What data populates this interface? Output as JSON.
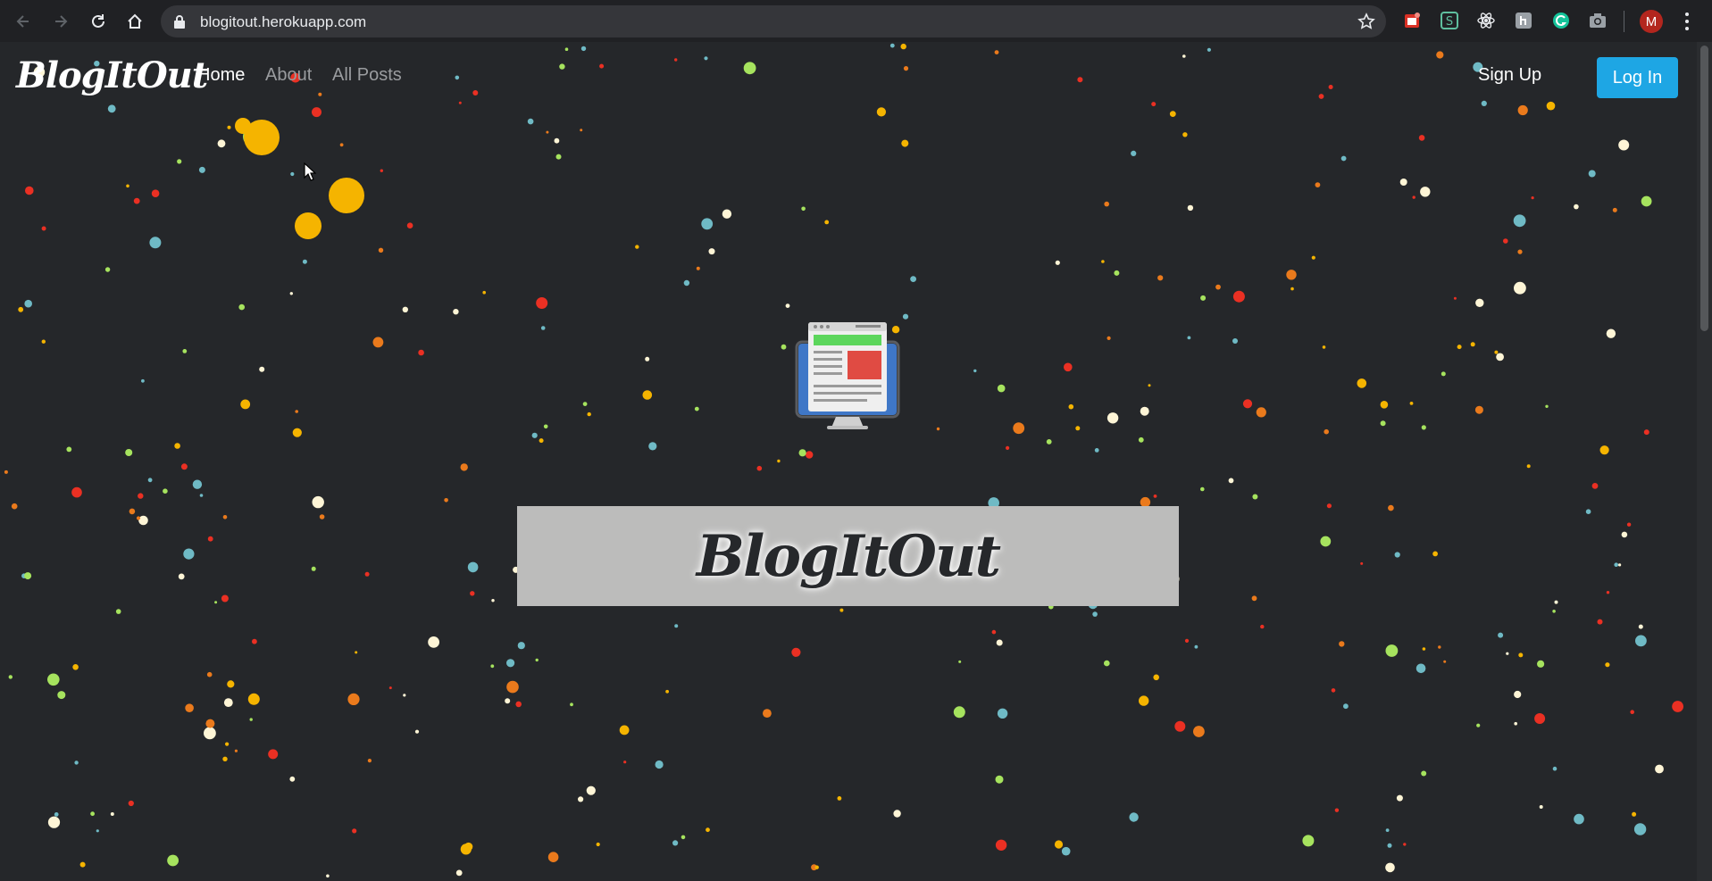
{
  "browser": {
    "url": "blogitout.herokuapp.com",
    "profile_initial": "M",
    "extensions": [
      "todo-extension-icon",
      "s-extension-icon",
      "react-devtools-icon",
      "reader-extension-icon",
      "grammarly-icon",
      "camera-extension-icon"
    ]
  },
  "navbar": {
    "brand": "BlogItOut",
    "links": [
      "Home",
      "About",
      "All Posts"
    ],
    "signup": "Sign Up",
    "login": "Log In"
  },
  "hero": {
    "icon": "blog-monitor-icon",
    "banner_title": "BlogItOut"
  },
  "colors": {
    "background": "#25272a",
    "accent": "#1ea6e4",
    "banner": "#bcbcbb",
    "particles": [
      "#f5b400",
      "#ea3023",
      "#6fbac5",
      "#a6e35e",
      "#fef5d6",
      "#ea7a1c"
    ]
  }
}
